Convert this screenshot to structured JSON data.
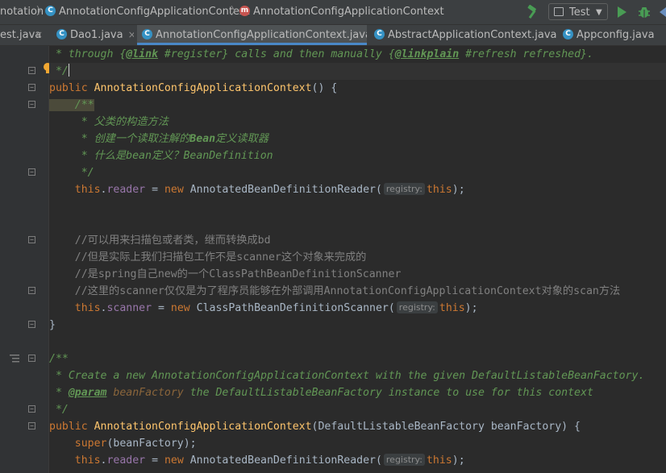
{
  "breadcrumb": {
    "item1": "notation",
    "item2": "AnnotationConfigApplicationContext",
    "item3": "AnnotationConfigApplicationContext"
  },
  "toolbar": {
    "run_config": "Test",
    "run_config_arrow": "▼"
  },
  "tabs": [
    {
      "label": "est.java",
      "icon": "c"
    },
    {
      "label": "Dao1.java",
      "icon": "c"
    },
    {
      "label": "AnnotationConfigApplicationContext.java",
      "icon": "c"
    },
    {
      "label": "AbstractApplicationContext.java",
      "icon": "c"
    },
    {
      "label": "Appconfig.java",
      "icon": "c"
    }
  ],
  "tab_close_glyph": "×",
  "code": {
    "l1_a": " * through {",
    "l1_b": "@link",
    "l1_c": " #register} calls and then manually {",
    "l1_d": "@linkplain",
    "l1_e": " #refresh refreshed}.",
    "l2": " */",
    "l3_a": "public ",
    "l3_b": "AnnotationConfigApplicationContext",
    "l3_c": "() {",
    "l4": "    /**",
    "l5": "     * 父类的构造方法",
    "l6_a": "     * 创建一个读取注解的",
    "l6_b": "Bean",
    "l6_c": "定义读取器",
    "l7_a": "     * 什么是",
    "l7_b": "bean",
    "l7_c": "定义？BeanDefinition",
    "l8": "     */",
    "l9_a": "    this",
    "l9_b": ".",
    "l9_c": "reader",
    "l9_d": " = ",
    "l9_e": "new ",
    "l9_f": "AnnotatedBeanDefinitionReader(",
    "l9_hint": "registry:",
    "l9_g": "this",
    "l9_h": ");",
    "l12": "    //可以用来扫描包或者类，继而转换成bd",
    "l13": "    //但是实际上我们扫描包工作不是scanner这个对象来完成的",
    "l14": "    //是spring自己new的一个ClassPathBeanDefinitionScanner",
    "l15": "    //这里的scanner仅仅是为了程序员能够在外部调用AnnotationConfigApplicationContext对象的scan方法",
    "l16_a": "    this",
    "l16_b": ".",
    "l16_c": "scanner",
    "l16_d": " = ",
    "l16_e": "new ",
    "l16_f": "ClassPathBeanDefinitionScanner(",
    "l16_hint": "registry:",
    "l16_g": "this",
    "l16_h": ");",
    "l17": "}",
    "l19": "/**",
    "l20": " * Create a new AnnotationConfigApplicationContext with the given DefaultListableBeanFactory.",
    "l21_a": " * ",
    "l21_b": "@param",
    "l21_c": " beanFactory",
    "l21_d": " the DefaultListableBeanFactory instance to use for this context",
    "l22": " */",
    "l23_a": "public ",
    "l23_b": "AnnotationConfigApplicationContext",
    "l23_c": "(DefaultListableBeanFactory beanFactory) {",
    "l24_a": "    super",
    "l24_b": "(beanFactory);",
    "l25_a": "    this",
    "l25_b": ".",
    "l25_c": "reader",
    "l25_d": " = ",
    "l25_e": "new ",
    "l25_f": "AnnotatedBeanDefinitionReader(",
    "l25_hint": "registry:",
    "l25_g": "this",
    "l25_h": ");"
  },
  "colors": {
    "keyword": "#cc7832",
    "method": "#ffc66d",
    "doc_comment": "#629755",
    "line_comment": "#808080",
    "field": "#9876aa",
    "accent": "#4a88c7"
  }
}
